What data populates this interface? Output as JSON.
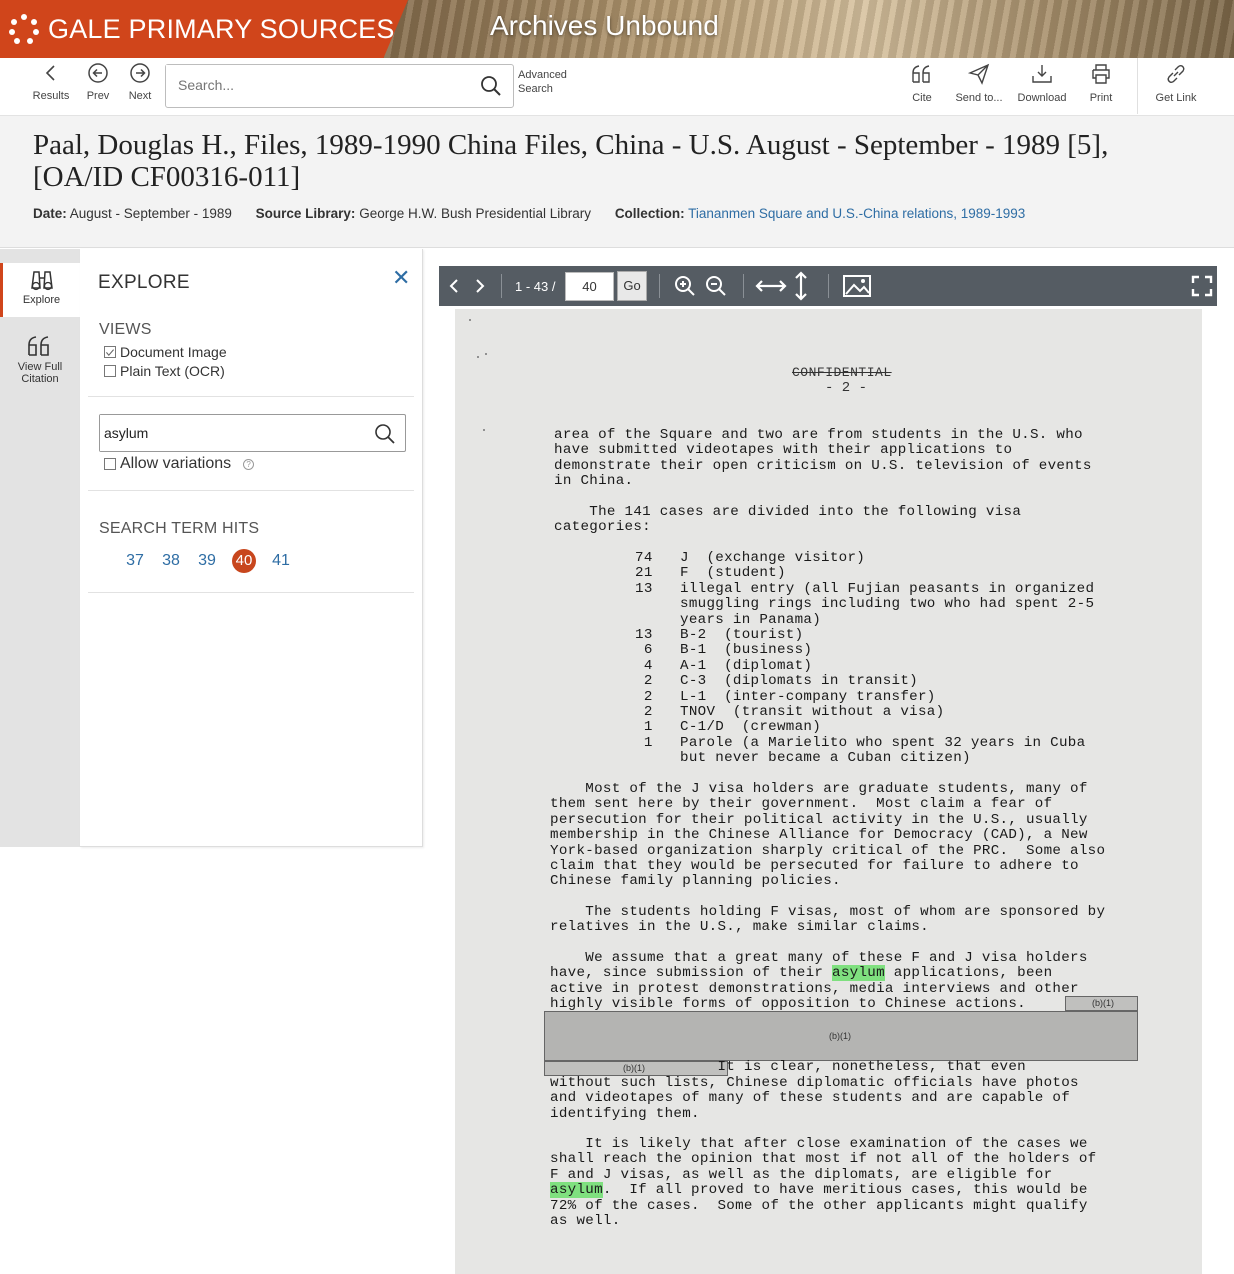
{
  "banner": {
    "brand": "GALE PRIMARY SOURCES",
    "product": "Archives Unbound",
    "brand_color": "#d0451b"
  },
  "toolbar": {
    "results": "Results",
    "prev": "Prev",
    "next": "Next",
    "search_placeholder": "Search...",
    "advanced_line1": "Advanced",
    "advanced_line2": "Search",
    "cite": "Cite",
    "send": "Send to...",
    "download": "Download",
    "print": "Print",
    "get_link": "Get Link"
  },
  "document": {
    "title": "Paal, Douglas H., Files, 1989-1990 China Files, China - U.S. August - September - 1989 [5], [OA/ID CF00316-011]",
    "date_label": "Date:",
    "date": "August - September - 1989",
    "source_label": "Source Library:",
    "source": "George H.W. Bush Presidential Library",
    "collection_label": "Collection:",
    "collection": "Tiananmen Square and U.S.-China relations, 1989-1993"
  },
  "rail": {
    "explore": "Explore",
    "citation_line1": "View Full",
    "citation_line2": "Citation"
  },
  "explore": {
    "title": "EXPLORE",
    "views_label": "VIEWS",
    "view_image": "Document Image",
    "view_image_checked": true,
    "view_text": "Plain Text (OCR)",
    "view_text_checked": false,
    "keyword": "asylum",
    "allow_variations": "Allow variations",
    "allow_variations_checked": false,
    "hits_label": "SEARCH TERM HITS",
    "hits": [
      "37",
      "38",
      "39",
      "40",
      "41"
    ],
    "active_hit": "40"
  },
  "viewer": {
    "page_range": "1 - 43 /",
    "current_page": "40",
    "go": "Go"
  },
  "page_text": {
    "confidential": "CONFIDENTIAL",
    "page_number": "- 2 -",
    "para1": "area of the Square and two are from students in the U.S. who\nhave submitted videotapes with their applications to\ndemonstrate their open criticism on U.S. television of events\nin China.",
    "para2": "    The 141 cases are divided into the following visa\ncategories:",
    "visa_counts": "74\n21\n13\n\n\n13\n6\n4\n2\n2\n2\n1\n1",
    "visa_types": "J  (exchange visitor)\nF  (student)\nillegal entry (all Fujian peasants in organized\nsmuggling rings including two who had spent 2-5\nyears in Panama)\nB-2  (tourist)\nB-1  (business)\nA-1  (diplomat)\nC-3  (diplomats in transit)\nL-1  (inter-company transfer)\nTNOV  (transit without a visa)\nC-1/D  (crewman)\nParole (a Marielito who spent 32 years in Cuba\nbut never became a Cuban citizen)",
    "para3": "    Most of the J visa holders are graduate students, many of\nthem sent here by their government.  Most claim a fear of\npersecution for their political activity in the U.S., usually\nmembership in the Chinese Alliance for Democracy (CAD), a New\nYork-based organization sharply critical of the PRC.  Some also\nclaim that they would be persecuted for failure to adhere to\nChinese family planning policies.",
    "para4": "    The students holding F visas, most of whom are sponsored by\nrelatives in the U.S., make similar claims.",
    "para5_a": "    We assume that a great many of these F and J visa holders\nhave, since submission of their ",
    "para5_hl": "asylum",
    "para5_b": " applications, been\nactive in protest demonstrations, media interviews and other\nhighly visible forms of opposition to Chinese actions.",
    "redaction_label": "(b)(1)",
    "para6_a": "                   It is clear, nonetheless, that even",
    "para6_b": "without such lists, Chinese diplomatic officials have photos\nand videotapes of many of these students and are capable of\nidentifying them.",
    "para7_a": "    It is likely that after close examination of the cases we\nshall reach the opinion that most if not all of the holders of\nF and J visas, as well as the diplomats, are eligible for\n",
    "para7_hl": "asylum",
    "para7_b": ".  If all proved to have meritious cases, this would be\n72% of the cases.  Some of the other applicants might qualify\nas well."
  }
}
